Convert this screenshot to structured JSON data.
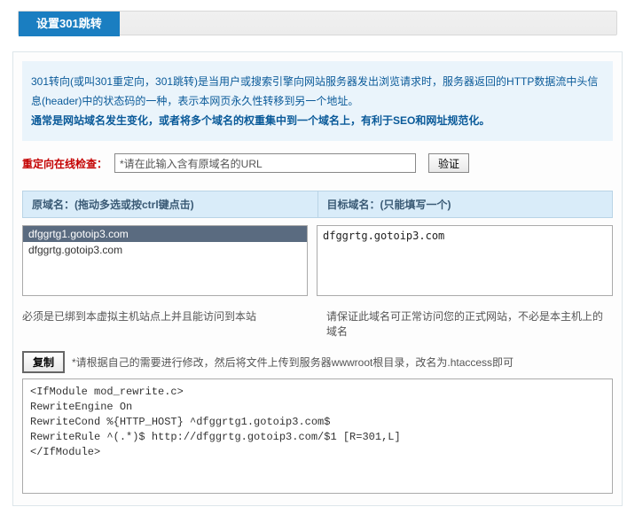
{
  "header": {
    "title": "设置301跳转"
  },
  "info": {
    "line1": "301转向(或叫301重定向，301跳转)是当用户或搜索引擎向网站服务器发出浏览请求时，服务器返回的HTTP数据流中头信息(header)中的状态码的一种，表示本网页永久性转移到另一个地址。",
    "line2": "通常是网站域名发生变化，或者将多个域名的权重集中到一个域名上，有利于SEO和网址规范化。"
  },
  "check": {
    "label": "重定向在线检查：",
    "placeholder": "*请在此输入含有原域名的URL",
    "button": "验证"
  },
  "columns": {
    "source_header": "原域名：(拖动多选或按ctrl键点击)",
    "target_header": "目标域名：(只能填写一个)",
    "source_items": [
      "dfggrtg1.gotoip3.com",
      "dfggrtg.gotoip3.com"
    ],
    "selected_index": 0,
    "target_value": "dfggrtg.gotoip3.com",
    "source_note": "必须是已绑到本虚拟主机站点上并且能访问到本站",
    "target_note": "请保证此域名可正常访问您的正式网站，不必是本主机上的域名"
  },
  "copy": {
    "button": "复制",
    "note": "*请根据自己的需要进行修改，然后将文件上传到服务器wwwroot根目录，改名为.htaccess即可"
  },
  "code": "<IfModule mod_rewrite.c>\nRewriteEngine On\nRewriteCond %{HTTP_HOST} ^dfggrtg1.gotoip3.com$\nRewriteRule ^(.*)$ http://dfggrtg.gotoip3.com/$1 [R=301,L]\n</IfModule>"
}
